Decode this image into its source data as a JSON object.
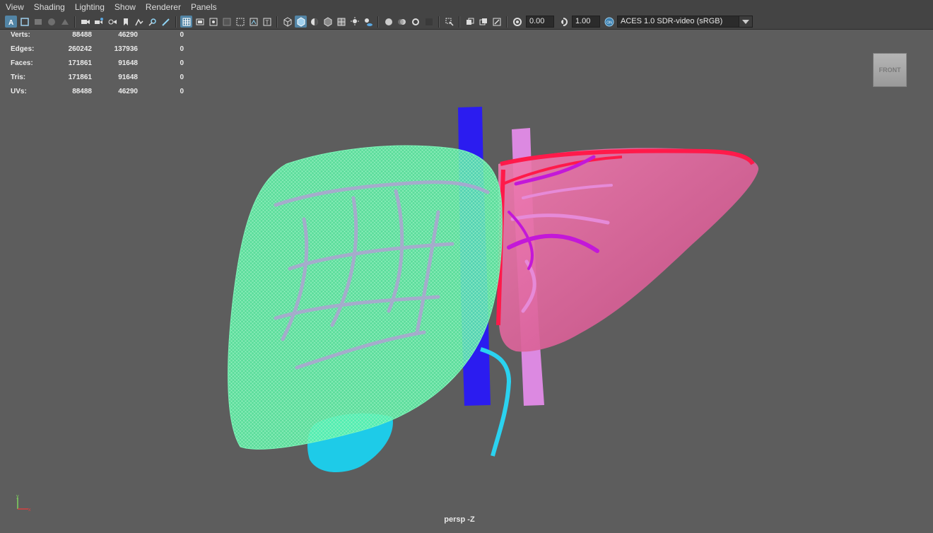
{
  "menubar": {
    "items": [
      "View",
      "Shading",
      "Lighting",
      "Show",
      "Renderer",
      "Panels"
    ]
  },
  "toolbar": {
    "exposure": "0.00",
    "gamma": "1.00",
    "color_management": "ACES 1.0 SDR-video (sRGB)",
    "accent": "#5285a6",
    "icons": [
      "select-icon",
      "camera-icon",
      "grid-icon",
      "film-gate-icon",
      "wireframe-icon",
      "smooth-shade-icon",
      "lighting-icon",
      "isolate-icon",
      "xray-icon"
    ]
  },
  "hud": {
    "rows": [
      {
        "label": "Verts:",
        "v1": "88488",
        "v2": "46290",
        "v3": "0"
      },
      {
        "label": "Edges:",
        "v1": "260242",
        "v2": "137936",
        "v3": "0"
      },
      {
        "label": "Faces:",
        "v1": "171861",
        "v2": "91648",
        "v3": "0"
      },
      {
        "label": "Tris:",
        "v1": "171861",
        "v2": "91648",
        "v3": "0"
      },
      {
        "label": "UVs:",
        "v1": "88488",
        "v2": "46290",
        "v3": "0"
      }
    ]
  },
  "viewcube": {
    "label": "FRONT"
  },
  "camera": {
    "label": "persp -Z"
  },
  "axis": {
    "y": "y",
    "x": "x"
  },
  "colors": {
    "viewport_bg": "#5d5d5d",
    "liver_wire": "#5ef3a8",
    "liver_left": "#e46aa0",
    "vena_cava": "#2b1cf0",
    "portal": "#e38be8",
    "artery": "#ff1a4a",
    "bile_duct": "#2ad2f0",
    "gallbladder": "#1ecbe8"
  }
}
